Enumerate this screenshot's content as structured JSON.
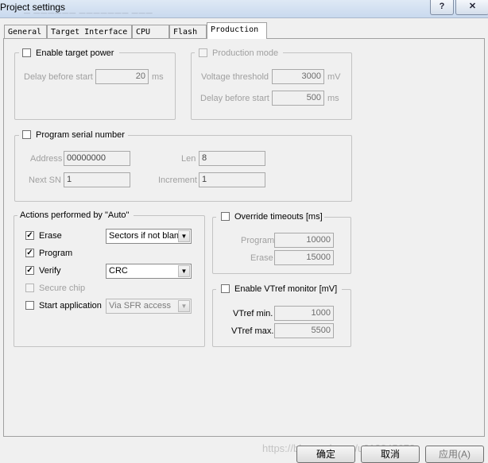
{
  "window": {
    "title": "Project settings",
    "ghost_menu": "—   ——————   ———————   ———",
    "help_glyph": "?",
    "close_glyph": "✕"
  },
  "tabs": [
    {
      "label": "General",
      "active": false
    },
    {
      "label": "Target Interface",
      "active": false
    },
    {
      "label": "CPU",
      "active": false
    },
    {
      "label": "Flash",
      "active": false
    },
    {
      "label": "Production",
      "active": true
    }
  ],
  "target_power": {
    "checkbox_label": "Enable target power",
    "checked": false,
    "delay_label": "Delay before start",
    "delay_value": "20",
    "delay_unit": "ms"
  },
  "production_mode": {
    "checkbox_label": "Production mode",
    "checked": false,
    "voltage_label": "Voltage threshold",
    "voltage_value": "3000",
    "voltage_unit": "mV",
    "delay_label": "Delay before start",
    "delay_value": "500",
    "delay_unit": "ms"
  },
  "serial": {
    "checkbox_label": "Program serial number",
    "checked": false,
    "address_label": "Address",
    "address_value": "00000000",
    "len_label": "Len",
    "len_value": "8",
    "next_sn_label": "Next SN",
    "next_sn_value": "1",
    "increment_label": "Increment",
    "increment_value": "1"
  },
  "actions": {
    "legend": "Actions performed by \"Auto\"",
    "check_glyph": "✓",
    "dropdown_glyph": "▼",
    "erase_label": "Erase",
    "erase_checked": true,
    "erase_option": "Sectors if not blan",
    "program_label": "Program",
    "program_checked": true,
    "verify_label": "Verify",
    "verify_checked": true,
    "verify_option": "CRC",
    "secure_label": "Secure chip",
    "secure_checked": false,
    "start_label": "Start application",
    "start_checked": false,
    "start_option": "Via SFR access"
  },
  "timeouts": {
    "checkbox_label": "Override timeouts [ms]",
    "checked": false,
    "program_label": "Program",
    "program_value": "10000",
    "erase_label": "Erase",
    "erase_value": "15000"
  },
  "vtref": {
    "checkbox_label": "Enable VTref monitor [mV]",
    "checked": false,
    "min_label": "VTref min.",
    "min_value": "1000",
    "max_label": "VTref max.",
    "max_value": "5500"
  },
  "footer": {
    "ok_label": "确定",
    "cancel_label": "取消",
    "apply_label": "应用(A)",
    "watermark": "https://blog.csdn.net/u012345678"
  }
}
